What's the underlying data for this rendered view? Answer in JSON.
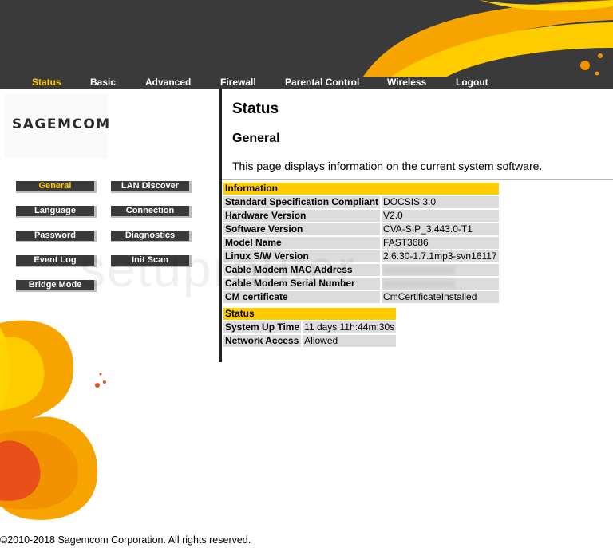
{
  "topnav": [
    {
      "label": "Status",
      "active": true
    },
    {
      "label": "Basic",
      "active": false
    },
    {
      "label": "Advanced",
      "active": false
    },
    {
      "label": "Firewall",
      "active": false
    },
    {
      "label": "Parental Control",
      "active": false
    },
    {
      "label": "Wireless",
      "active": false
    },
    {
      "label": "Logout",
      "active": false
    }
  ],
  "logo": {
    "text": "SAGEMCOM"
  },
  "sidebar": {
    "left": [
      "General",
      "Language",
      "Password",
      "Event Log",
      "Bridge Mode"
    ],
    "right": [
      "LAN Discover",
      "Connection",
      "Diagnostics",
      "Init Scan"
    ],
    "active": "General"
  },
  "page": {
    "title": "Status",
    "section": "General",
    "description": "This page displays information on the current system software."
  },
  "info_table": {
    "header": "Information",
    "rows": [
      {
        "label": "Standard Specification Compliant",
        "value": "DOCSIS 3.0"
      },
      {
        "label": "Hardware Version",
        "value": "V2.0"
      },
      {
        "label": "Software Version",
        "value": "CVA-SIP_3.443.0-T1"
      },
      {
        "label": "Model Name",
        "value": "FAST3686"
      },
      {
        "label": "Linux S/W Version",
        "value": "2.6.30-1.7.1mp3-svn16117"
      },
      {
        "label": "Cable Modem MAC Address",
        "value": ""
      },
      {
        "label": "Cable Modem Serial Number",
        "value": ""
      },
      {
        "label": "CM certificate",
        "value": "CmCertificateInstalled"
      }
    ]
  },
  "status_table": {
    "header": "Status",
    "rows": [
      {
        "label": "System Up Time",
        "value": "11 days 11h:44m:30s"
      },
      {
        "label": "Network Access",
        "value": "Allowed"
      }
    ]
  },
  "watermark": "setuprouter",
  "footer": "©2010-2018 Sagemcom Corporation. All rights reserved.",
  "colors": {
    "accent": "#ffcc00",
    "header_bg": "#3a3a3a",
    "row_bg": "#dcdcdc"
  }
}
